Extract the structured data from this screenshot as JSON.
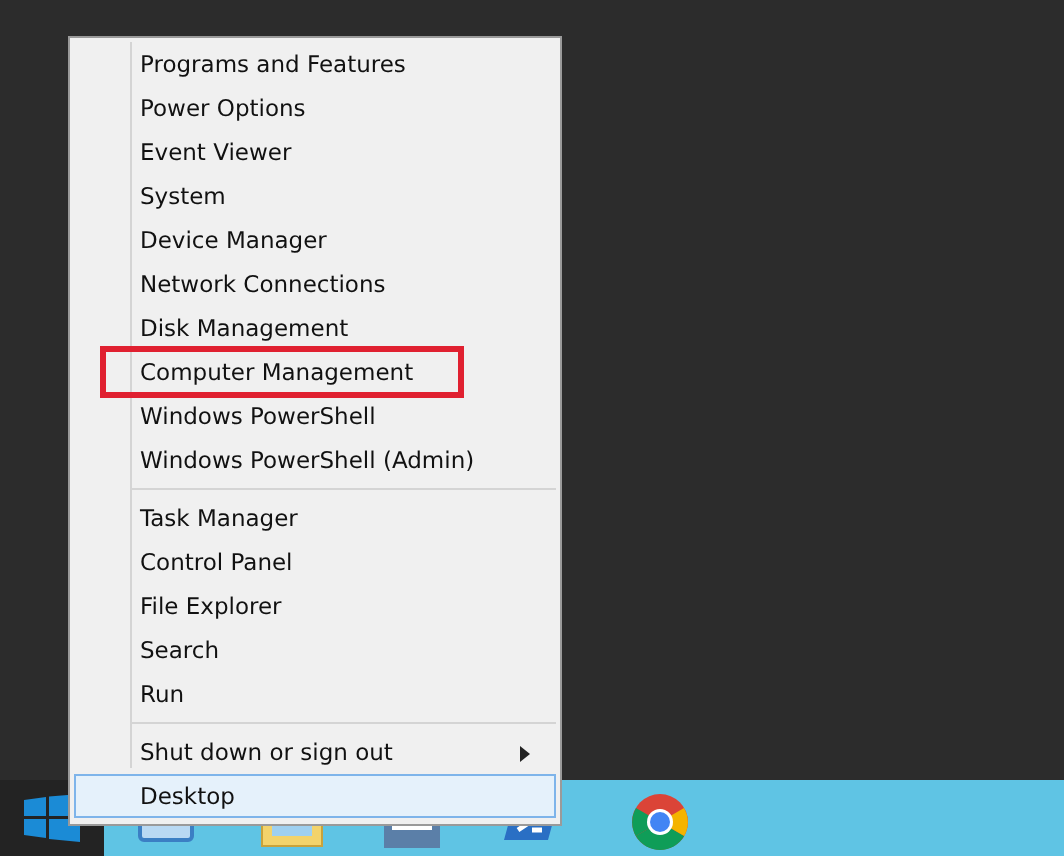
{
  "menu": {
    "groups": [
      {
        "items": [
          {
            "label": "Programs and Features",
            "kind": "item",
            "selected": false,
            "highlighted": false
          },
          {
            "label": "Power Options",
            "kind": "item",
            "selected": false,
            "highlighted": false
          },
          {
            "label": "Event Viewer",
            "kind": "item",
            "selected": false,
            "highlighted": false
          },
          {
            "label": "System",
            "kind": "item",
            "selected": false,
            "highlighted": false
          },
          {
            "label": "Device Manager",
            "kind": "item",
            "selected": false,
            "highlighted": false
          },
          {
            "label": "Network Connections",
            "kind": "item",
            "selected": false,
            "highlighted": false
          },
          {
            "label": "Disk Management",
            "kind": "item",
            "selected": false,
            "highlighted": false
          },
          {
            "label": "Computer Management",
            "kind": "item",
            "selected": false,
            "highlighted": true
          },
          {
            "label": "Windows PowerShell",
            "kind": "item",
            "selected": false,
            "highlighted": false
          },
          {
            "label": "Windows PowerShell (Admin)",
            "kind": "item",
            "selected": false,
            "highlighted": false
          }
        ]
      },
      {
        "items": [
          {
            "label": "Task Manager",
            "kind": "item",
            "selected": false,
            "highlighted": false
          },
          {
            "label": "Control Panel",
            "kind": "item",
            "selected": false,
            "highlighted": false
          },
          {
            "label": "File Explorer",
            "kind": "item",
            "selected": false,
            "highlighted": false
          },
          {
            "label": "Search",
            "kind": "item",
            "selected": false,
            "highlighted": false
          },
          {
            "label": "Run",
            "kind": "item",
            "selected": false,
            "highlighted": false
          }
        ]
      },
      {
        "items": [
          {
            "label": "Shut down or sign out",
            "kind": "submenu",
            "selected": false,
            "highlighted": false
          },
          {
            "label": "Desktop",
            "kind": "item",
            "selected": true,
            "highlighted": false
          }
        ]
      }
    ]
  }
}
